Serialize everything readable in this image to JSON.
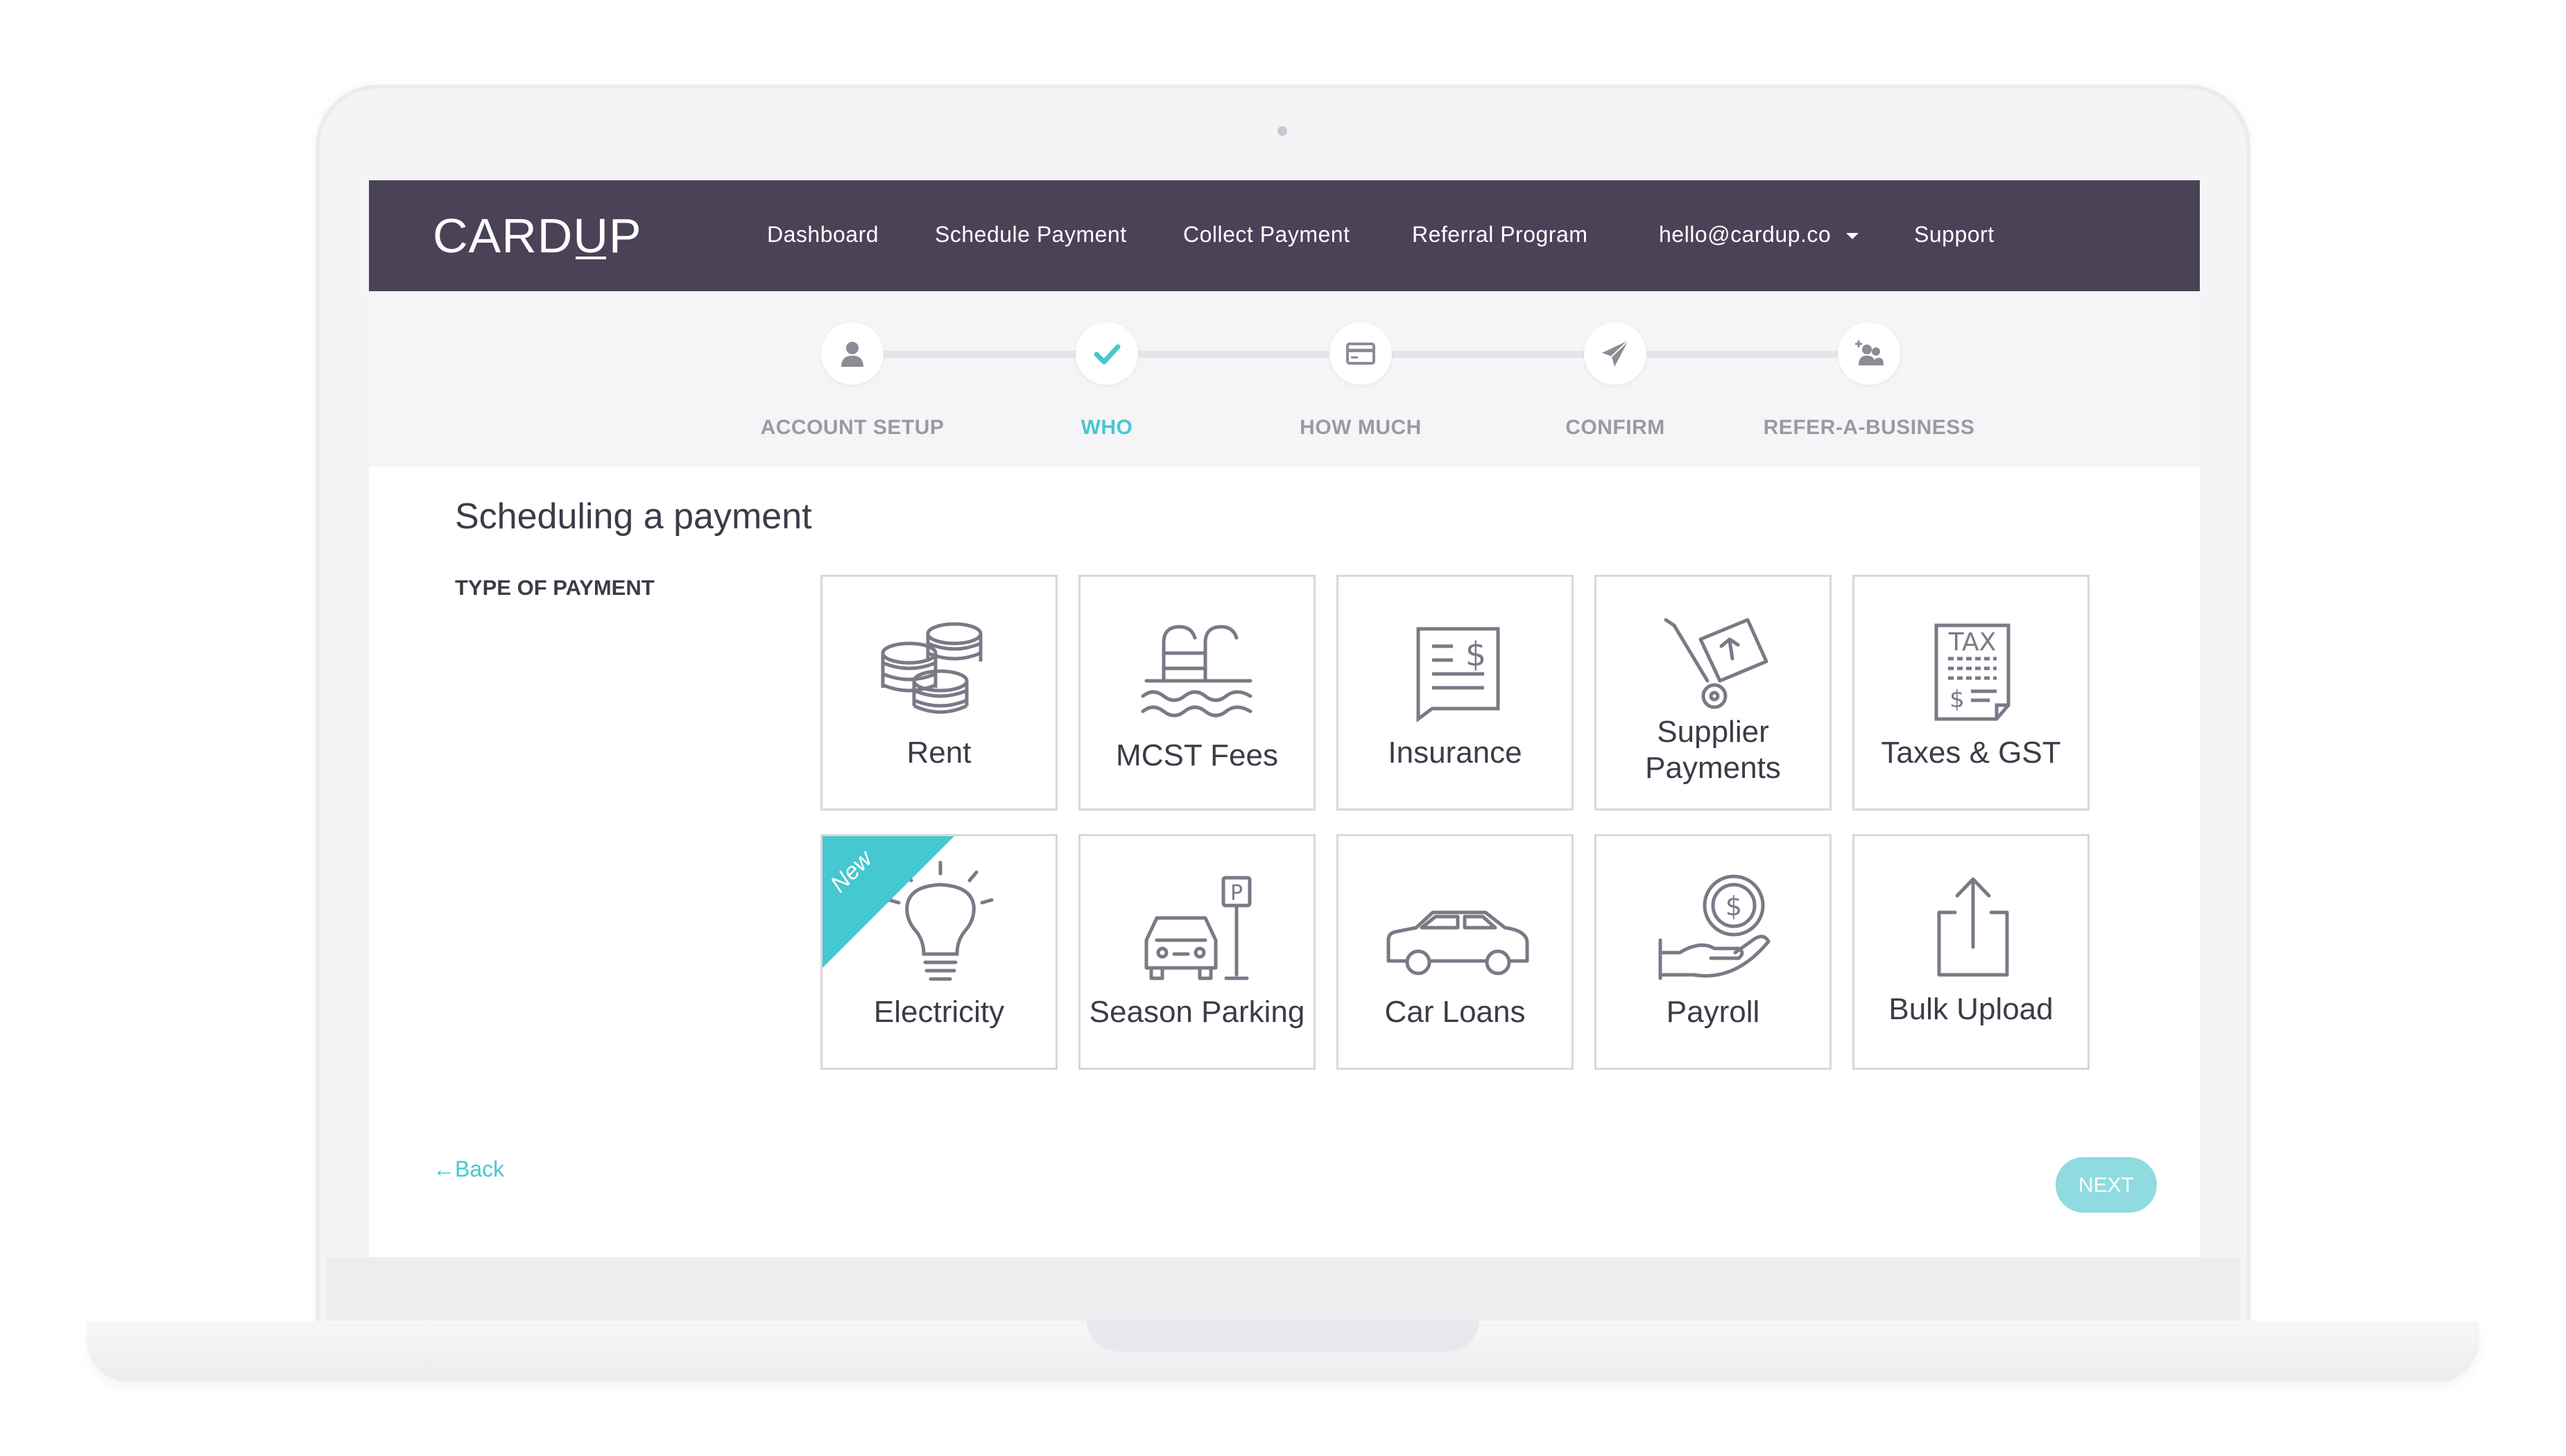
{
  "navbar": {
    "logo_prefix": "CARD",
    "logo_u": "U",
    "logo_suffix": "P",
    "items": [
      "Dashboard",
      "Schedule Payment",
      "Collect Payment",
      "Referral Program"
    ],
    "account": "hello@cardup.co",
    "support": "Support"
  },
  "stepper": {
    "steps": [
      {
        "label": "ACCOUNT SETUP",
        "icon": "user-icon"
      },
      {
        "label": "WHO",
        "icon": "checkmark-icon",
        "active": true
      },
      {
        "label": "HOW MUCH",
        "icon": "credit-card-icon"
      },
      {
        "label": "CONFIRM",
        "icon": "paper-plane-icon"
      },
      {
        "label": "REFER-A-BUSINESS",
        "icon": "add-users-icon"
      }
    ],
    "active_color": "#45c8cf"
  },
  "main": {
    "title": "Scheduling a payment",
    "type_label": "TYPE OF PAYMENT",
    "tiles": [
      {
        "label": "Rent",
        "icon": "coins-icon"
      },
      {
        "label": "MCST Fees",
        "icon": "pool-icon"
      },
      {
        "label": "Insurance",
        "icon": "document-dollar-icon"
      },
      {
        "label_line1": "Supplier",
        "label_line2": "Payments",
        "icon": "hand-truck-icon"
      },
      {
        "label": "Taxes & GST",
        "icon": "tax-document-icon"
      },
      {
        "label": "Electricity",
        "icon": "lightbulb-icon",
        "badge": "New"
      },
      {
        "label": "Season Parking",
        "icon": "car-parking-icon"
      },
      {
        "label": "Car Loans",
        "icon": "car-icon"
      },
      {
        "label": "Payroll",
        "icon": "hand-coin-icon"
      },
      {
        "label": "Bulk Upload",
        "icon": "upload-icon"
      }
    ],
    "back": "Back",
    "next": "NEXT"
  },
  "colors": {
    "navbar": "#4a4257",
    "accent": "#45c8cf",
    "next_button": "#8fdbe0",
    "text": "#3f3a48"
  }
}
